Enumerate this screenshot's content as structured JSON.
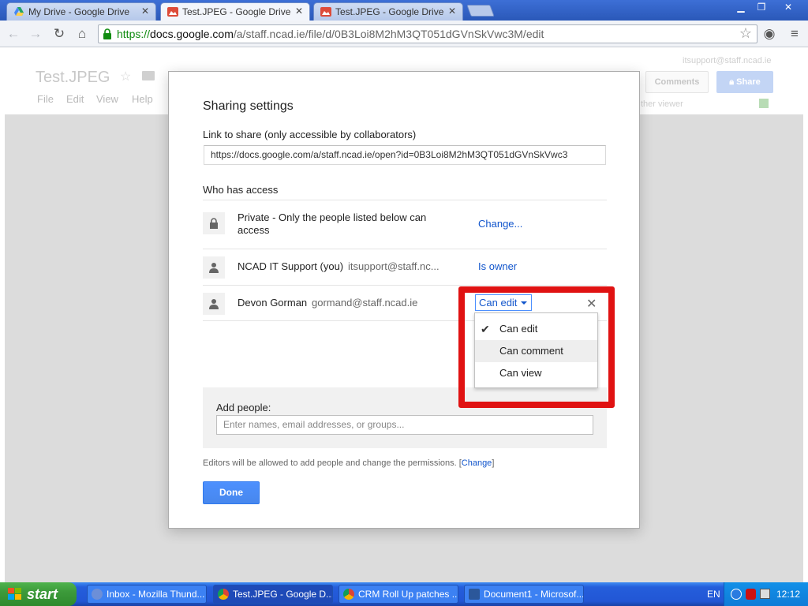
{
  "browser": {
    "tabs": [
      {
        "title": "My Drive - Google Drive",
        "close": "✕"
      },
      {
        "title": "Test.JPEG - Google Drive",
        "close": "✕"
      },
      {
        "title": "Test.JPEG - Google Drive",
        "close": "✕"
      }
    ],
    "url_secure": "https://",
    "url_host": "docs.google.com",
    "url_path": "/a/staff.ncad.ie/file/d/0B3Loi8M2hM3QT051dGVnSkVwc3M/edit"
  },
  "page": {
    "doc_title": "Test.JPEG",
    "menu": [
      "File",
      "Edit",
      "View",
      "Help"
    ],
    "user_email": "itsupport@staff.ncad.ie",
    "comments_label": "Comments",
    "share_label": "Share",
    "viewer_text": "ther viewer"
  },
  "dialog": {
    "title": "Sharing settings",
    "link_label": "Link to share (only accessible by collaborators)",
    "link_value": "https://docs.google.com/a/staff.ncad.ie/open?id=0B3Loi8M2hM3QT051dGVnSkVwc3",
    "who_label": "Who has access",
    "rows": [
      {
        "name": "Private - Only the people listed below can access",
        "action": "Change..."
      },
      {
        "name": "NCAD IT Support (you)",
        "email": "itsupport@staff.nc...",
        "action": "Is owner"
      },
      {
        "name": "Devon Gorman",
        "email": "gormand@staff.ncad.ie",
        "action": "Can edit"
      }
    ],
    "remove": "✕",
    "dropdown": [
      {
        "label": "Can edit",
        "check": "✔"
      },
      {
        "label": "Can comment"
      },
      {
        "label": "Can view"
      }
    ],
    "add_label": "Add people:",
    "add_placeholder": "Enter names, email addresses, or groups...",
    "note_text": "Editors will be allowed to add people and change the permissions. [",
    "note_link": "Change",
    "note_end": "]",
    "done_label": "Done"
  },
  "taskbar": {
    "start": "start",
    "tasks": [
      "Inbox - Mozilla Thund...",
      "Test.JPEG - Google D...",
      "CRM Roll Up patches ...",
      "Document1 - Microsof..."
    ],
    "lang": "EN",
    "clock": "12:12"
  },
  "colors": {
    "highlight": "#e01212",
    "accent": "#4d90fe",
    "link": "#1155cc"
  }
}
